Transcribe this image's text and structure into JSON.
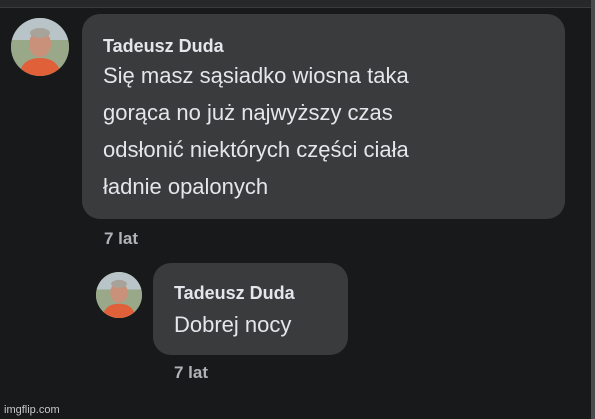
{
  "comments": [
    {
      "author": "Tadeusz Duda",
      "text": "Się masz sąsiadko wiosna taka gorąca no już najwyższy czas odsłonić niektórych części ciała ładnie opalonych",
      "timestamp": "7 lat",
      "avatar_icon": "profile-photo-icon"
    }
  ],
  "replies": [
    {
      "author": "Tadeusz Duda",
      "text": "Dobrej nocy",
      "timestamp": "7 lat",
      "avatar_icon": "profile-photo-icon"
    }
  ],
  "watermark": "imgflip.com",
  "colors": {
    "background": "#18191a",
    "bubble": "#3a3b3c",
    "text": "#e4e6eb",
    "secondary_text": "#b0b3b8"
  }
}
